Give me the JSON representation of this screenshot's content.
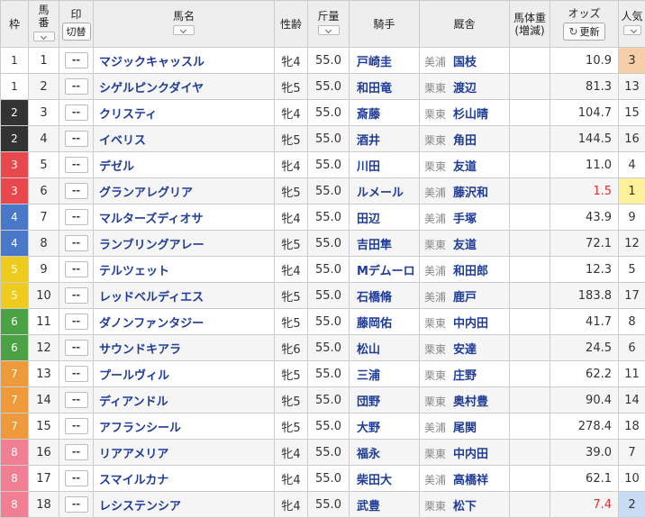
{
  "headers": {
    "waku": "枠",
    "umaban": "馬番",
    "mark": "印",
    "mark_toggle": "切替",
    "horse_name": "馬名",
    "sex_age": "性齢",
    "weight": "斤量",
    "jockey": "騎手",
    "trainer": "厩舎",
    "body_weight": "馬体重",
    "body_weight_change": "(増減)",
    "odds": "オッズ",
    "refresh": "更新",
    "popularity": "人気"
  },
  "colors": {
    "waku": {
      "1": {
        "bg": "#ffffff",
        "fg": "#333333"
      },
      "2": {
        "bg": "#333333",
        "fg": "#ffffff"
      },
      "3": {
        "bg": "#e8474c",
        "fg": "#ffffff"
      },
      "4": {
        "bg": "#4a78c9",
        "fg": "#ffffff"
      },
      "5": {
        "bg": "#eecb1c",
        "fg": "#ffffff"
      },
      "6": {
        "bg": "#4ba245",
        "fg": "#ffffff"
      },
      "7": {
        "bg": "#ee9a3a",
        "fg": "#ffffff"
      },
      "8": {
        "bg": "#f07f94",
        "fg": "#ffffff"
      }
    }
  },
  "rows": [
    {
      "waku": "1",
      "umaban": "1",
      "mark": "--",
      "name": "マジックキャッスル",
      "sex_age": "牝4",
      "weight": "55.0",
      "jockey": "戸崎圭",
      "region": "美浦",
      "trainer": "国枝",
      "body_weight": "",
      "odds": "10.9",
      "pop": "3"
    },
    {
      "waku": "1",
      "umaban": "2",
      "mark": "--",
      "name": "シゲルピンクダイヤ",
      "sex_age": "牝5",
      "weight": "55.0",
      "jockey": "和田竜",
      "region": "栗東",
      "trainer": "渡辺",
      "body_weight": "",
      "odds": "81.3",
      "pop": "13"
    },
    {
      "waku": "2",
      "umaban": "3",
      "mark": "--",
      "name": "クリスティ",
      "sex_age": "牝4",
      "weight": "55.0",
      "jockey": "斎藤",
      "region": "栗東",
      "trainer": "杉山晴",
      "body_weight": "",
      "odds": "104.7",
      "pop": "15"
    },
    {
      "waku": "2",
      "umaban": "4",
      "mark": "--",
      "name": "イベリス",
      "sex_age": "牝5",
      "weight": "55.0",
      "jockey": "酒井",
      "region": "栗東",
      "trainer": "角田",
      "body_weight": "",
      "odds": "144.5",
      "pop": "16"
    },
    {
      "waku": "3",
      "umaban": "5",
      "mark": "--",
      "name": "デゼル",
      "sex_age": "牝4",
      "weight": "55.0",
      "jockey": "川田",
      "region": "栗東",
      "trainer": "友道",
      "body_weight": "",
      "odds": "11.0",
      "pop": "4"
    },
    {
      "waku": "3",
      "umaban": "6",
      "mark": "--",
      "name": "グランアレグリア",
      "sex_age": "牝5",
      "weight": "55.0",
      "jockey": "ルメール",
      "region": "美浦",
      "trainer": "藤沢和",
      "body_weight": "",
      "odds": "1.5",
      "pop": "1"
    },
    {
      "waku": "4",
      "umaban": "7",
      "mark": "--",
      "name": "マルターズディオサ",
      "sex_age": "牝4",
      "weight": "55.0",
      "jockey": "田辺",
      "region": "美浦",
      "trainer": "手塚",
      "body_weight": "",
      "odds": "43.9",
      "pop": "9"
    },
    {
      "waku": "4",
      "umaban": "8",
      "mark": "--",
      "name": "ランブリングアレー",
      "sex_age": "牝5",
      "weight": "55.0",
      "jockey": "吉田隼",
      "region": "栗東",
      "trainer": "友道",
      "body_weight": "",
      "odds": "72.1",
      "pop": "12"
    },
    {
      "waku": "5",
      "umaban": "9",
      "mark": "--",
      "name": "テルツェット",
      "sex_age": "牝4",
      "weight": "55.0",
      "jockey": "Mデムーロ",
      "region": "美浦",
      "trainer": "和田郎",
      "body_weight": "",
      "odds": "12.3",
      "pop": "5"
    },
    {
      "waku": "5",
      "umaban": "10",
      "mark": "--",
      "name": "レッドベルディエス",
      "sex_age": "牝5",
      "weight": "55.0",
      "jockey": "石橋脩",
      "region": "美浦",
      "trainer": "鹿戸",
      "body_weight": "",
      "odds": "183.8",
      "pop": "17"
    },
    {
      "waku": "6",
      "umaban": "11",
      "mark": "--",
      "name": "ダノンファンタジー",
      "sex_age": "牝5",
      "weight": "55.0",
      "jockey": "藤岡佑",
      "region": "栗東",
      "trainer": "中内田",
      "body_weight": "",
      "odds": "41.7",
      "pop": "8"
    },
    {
      "waku": "6",
      "umaban": "12",
      "mark": "--",
      "name": "サウンドキアラ",
      "sex_age": "牝6",
      "weight": "55.0",
      "jockey": "松山",
      "region": "栗東",
      "trainer": "安達",
      "body_weight": "",
      "odds": "24.5",
      "pop": "6"
    },
    {
      "waku": "7",
      "umaban": "13",
      "mark": "--",
      "name": "プールヴィル",
      "sex_age": "牝5",
      "weight": "55.0",
      "jockey": "三浦",
      "region": "栗東",
      "trainer": "庄野",
      "body_weight": "",
      "odds": "62.2",
      "pop": "11"
    },
    {
      "waku": "7",
      "umaban": "14",
      "mark": "--",
      "name": "ディアンドル",
      "sex_age": "牝5",
      "weight": "55.0",
      "jockey": "団野",
      "region": "栗東",
      "trainer": "奥村豊",
      "body_weight": "",
      "odds": "90.4",
      "pop": "14"
    },
    {
      "waku": "7",
      "umaban": "15",
      "mark": "--",
      "name": "アフランシール",
      "sex_age": "牝5",
      "weight": "55.0",
      "jockey": "大野",
      "region": "美浦",
      "trainer": "尾関",
      "body_weight": "",
      "odds": "278.4",
      "pop": "18"
    },
    {
      "waku": "8",
      "umaban": "16",
      "mark": "--",
      "name": "リアアメリア",
      "sex_age": "牝4",
      "weight": "55.0",
      "jockey": "福永",
      "region": "栗東",
      "trainer": "中内田",
      "body_weight": "",
      "odds": "39.0",
      "pop": "7"
    },
    {
      "waku": "8",
      "umaban": "17",
      "mark": "--",
      "name": "スマイルカナ",
      "sex_age": "牝4",
      "weight": "55.0",
      "jockey": "柴田大",
      "region": "美浦",
      "trainer": "高橋祥",
      "body_weight": "",
      "odds": "62.1",
      "pop": "10"
    },
    {
      "waku": "8",
      "umaban": "18",
      "mark": "--",
      "name": "レシステンシア",
      "sex_age": "牝4",
      "weight": "55.0",
      "jockey": "武豊",
      "region": "栗東",
      "trainer": "松下",
      "body_weight": "",
      "odds": "7.4",
      "pop": "2"
    }
  ]
}
